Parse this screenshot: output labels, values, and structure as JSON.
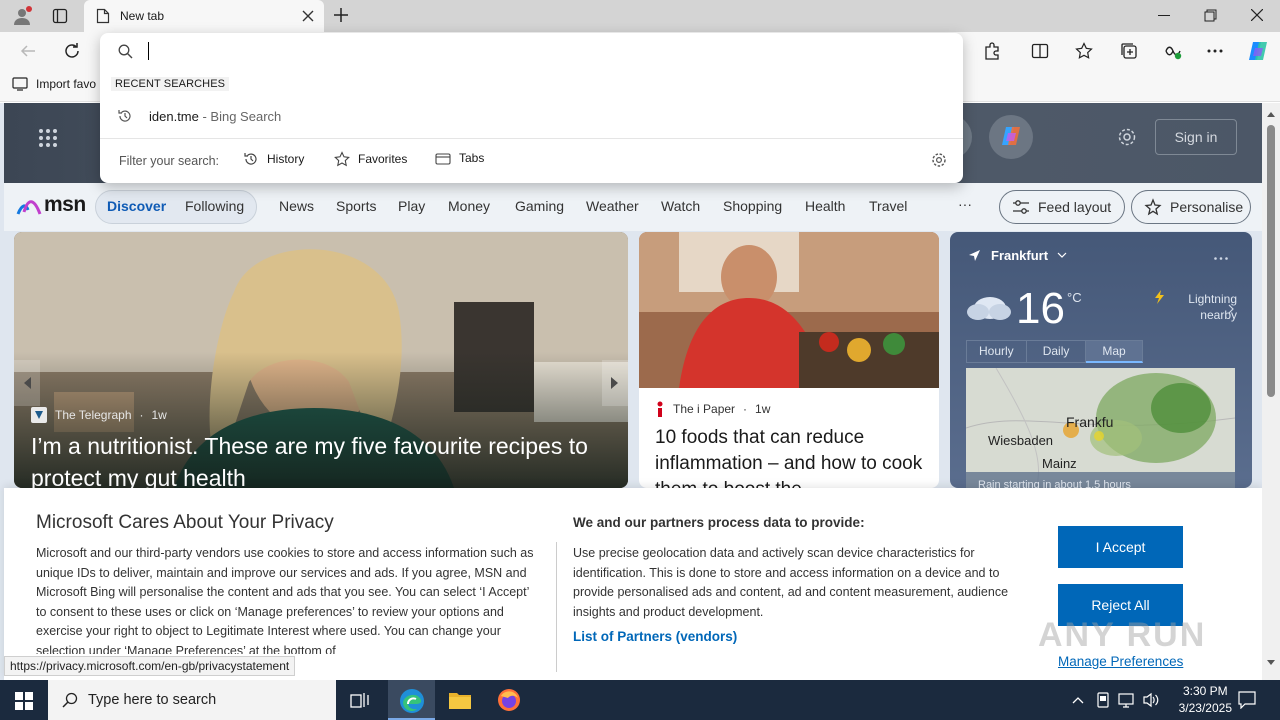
{
  "browser": {
    "tab_title": "New tab",
    "new_tab_symbol": "+",
    "favorites_bar_item": "Import favo",
    "window_controls": [
      "minimize-icon",
      "restore-icon",
      "close-icon"
    ]
  },
  "omnibox": {
    "recent_label": "RECENT SEARCHES",
    "suggestion_query": "iden.tme",
    "suggestion_source": " - Bing Search",
    "filter_label": "Filter your search:",
    "filters": [
      "History",
      "Favorites",
      "Tabs"
    ]
  },
  "msn": {
    "logo": "msn",
    "sign_in": "Sign in",
    "nav": {
      "discover": "Discover",
      "following": "Following",
      "items": [
        "News",
        "Sports",
        "Play",
        "Money",
        "Gaming",
        "Weather",
        "Watch",
        "Shopping",
        "Health",
        "Travel"
      ],
      "more": "···",
      "feed_layout": "Feed layout",
      "personalise": "Personalise"
    },
    "main_card": {
      "source": "The Telegraph",
      "age": "1w",
      "headline": "I’m a nutritionist. These are my five favourite recipes to protect my gut health"
    },
    "mid_card": {
      "source": "The i Paper",
      "age": "1w",
      "headline": "10 foods that can reduce inflammation – and how to cook them to boost the"
    },
    "weather": {
      "city": "Frankfurt",
      "temp": "16",
      "unit": "°C",
      "alert_line1": "Lightning",
      "alert_line2": "nearby",
      "tabs": [
        "Hourly",
        "Daily",
        "Map"
      ],
      "map_labels": [
        "Frankfu",
        "Wiesbaden",
        "Mainz"
      ],
      "footer": "Rain starting in about 1.5 hours"
    }
  },
  "privacy": {
    "title": "Microsoft Cares About Your Privacy",
    "body": "Microsoft and our third-party vendors use cookies to store and access information such as unique IDs to deliver, maintain and improve our services and ads. If you agree, MSN and Microsoft Bing will personalise the content and ads that you see. You can select ‘I Accept’ to consent to these uses or click on ‘Manage preferences’ to review your options and exercise your right to object to Legitimate Interest where used.  You can change your selection under ‘Manage Preferences’ at the bottom of",
    "title2": "We and our partners process data to provide:",
    "body2": "Use precise geolocation data and actively scan device characteristics for identification. This is done to store and access information on a device and to provide personalised ads and content, ad and content measurement, audience insights and product development.",
    "partners_link": "List of Partners (vendors)",
    "accept": "I Accept",
    "reject": "Reject All",
    "manage": "Manage Preferences"
  },
  "status_url": "https://privacy.microsoft.com/en-gb/privacystatement",
  "watermark": "ANY RUN",
  "taskbar": {
    "search_placeholder": "Type here to search",
    "time": "3:30 PM",
    "date": "3/23/2025"
  }
}
